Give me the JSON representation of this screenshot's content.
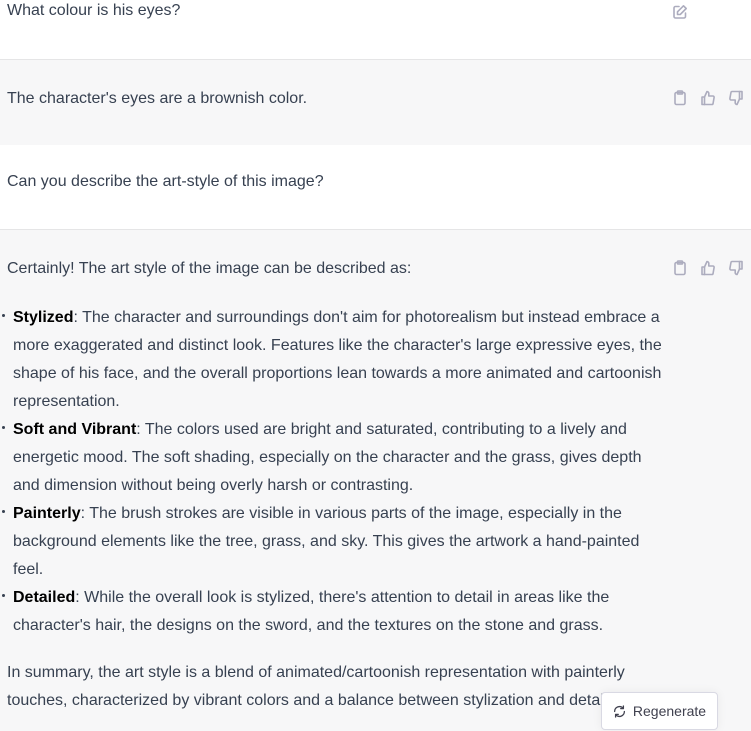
{
  "messages": [
    {
      "role": "user",
      "text": "What colour is his eyes?"
    },
    {
      "role": "assistant",
      "text": "The character's eyes are a brownish color."
    },
    {
      "role": "user",
      "text": "Can you describe the art-style of this image?"
    },
    {
      "role": "assistant",
      "intro": "Certainly! The art style of the image can be described as:",
      "bullets": [
        {
          "term": "Stylized",
          "lines": [
            ": The character and surroundings don't aim for photorealism but instead embrace a",
            "more exaggerated and distinct look. Features like the character's large expressive eyes, the",
            "shape of his face, and the overall proportions lean towards a more animated and cartoonish",
            "representation."
          ]
        },
        {
          "term": "Soft and Vibrant",
          "lines": [
            ": The colors used are bright and saturated, contributing to a lively and",
            "energetic mood. The soft shading, especially on the character and the grass, gives depth",
            "and dimension without being overly harsh or contrasting."
          ]
        },
        {
          "term": "Painterly",
          "lines": [
            ": The brush strokes are visible in various parts of the image, especially in the",
            "background elements like the tree, grass, and sky. This gives the artwork a hand-painted",
            "feel."
          ]
        },
        {
          "term": "Detailed",
          "lines": [
            ": While the overall look is stylized, there's attention to detail in areas like the",
            "character's hair, the designs on the sword, and the textures on the stone and grass."
          ]
        }
      ],
      "summary_lines": [
        "In summary, the art style is a blend of animated/cartoonish representation with painterly",
        "touches, characterized by vibrant colors and a balance between stylization and detai"
      ]
    }
  ],
  "icons": {
    "edit": "edit-icon",
    "copy": "clipboard-icon",
    "like": "thumbs-up-icon",
    "dislike": "thumbs-down-icon",
    "regenerate": "refresh-icon"
  },
  "regenerate_label": "Regenerate",
  "colors": {
    "assistant_bg": "#f7f7f8",
    "icon": "#acacbe",
    "text": "#374151"
  }
}
